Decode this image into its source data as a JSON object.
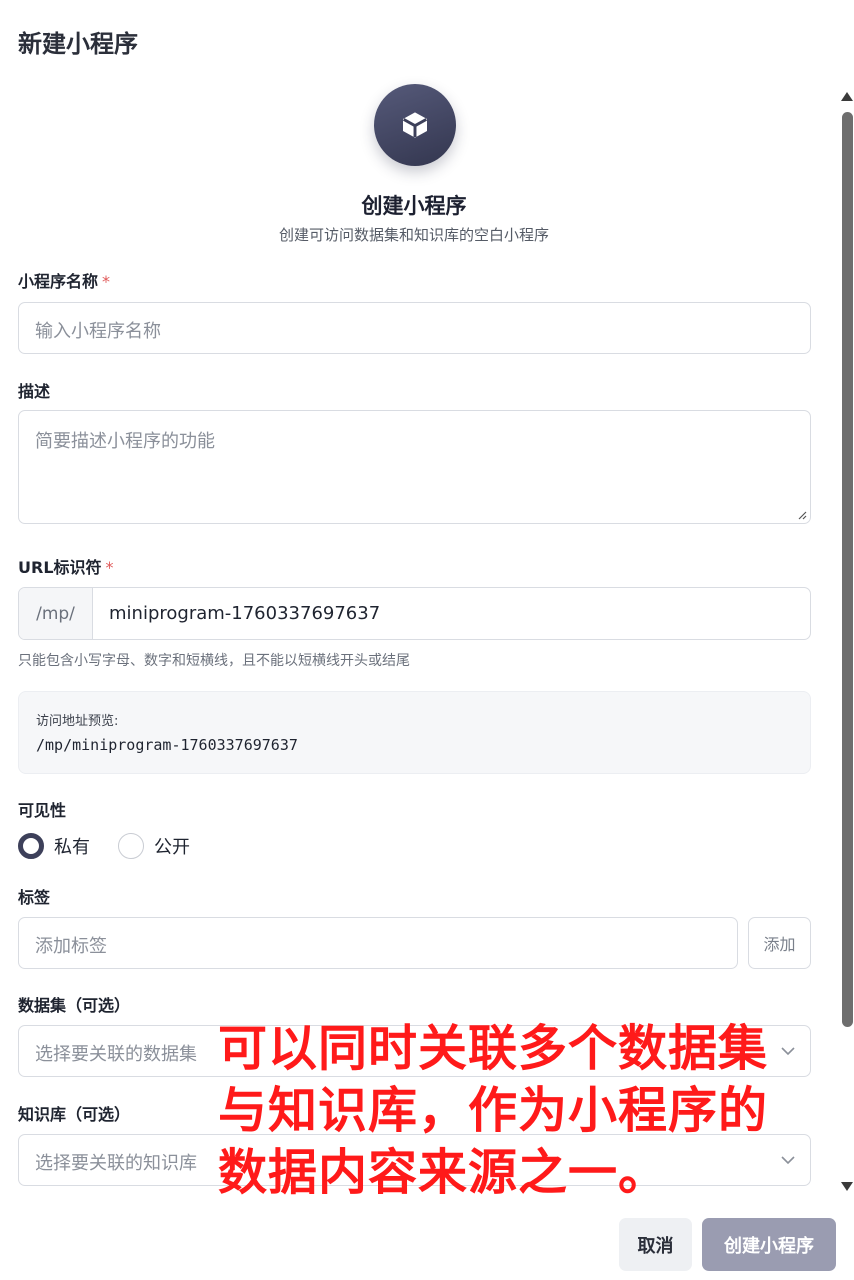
{
  "dialog": {
    "title": "新建小程序"
  },
  "hero": {
    "icon": "cube-icon",
    "title": "创建小程序",
    "subtitle": "创建可访问数据集和知识库的空白小程序"
  },
  "form": {
    "name": {
      "label": "小程序名称",
      "required_mark": "*",
      "placeholder": "输入小程序名称"
    },
    "description": {
      "label": "描述",
      "placeholder": "简要描述小程序的功能"
    },
    "url": {
      "label": "URL标识符",
      "required_mark": "*",
      "prefix": "/mp/",
      "value": "miniprogram-1760337697637",
      "hint": "只能包含小写字母、数字和短横线，且不能以短横线开头或结尾"
    },
    "preview": {
      "label": "访问地址预览:",
      "url": "/mp/miniprogram-1760337697637"
    },
    "visibility": {
      "label": "可见性",
      "options": [
        {
          "label": "私有",
          "selected": true
        },
        {
          "label": "公开",
          "selected": false
        }
      ]
    },
    "tags": {
      "label": "标签",
      "placeholder": "添加标签",
      "add_label": "添加"
    },
    "datasets": {
      "label": "数据集（可选）",
      "placeholder": "选择要关联的数据集"
    },
    "knowledge": {
      "label": "知识库（可选）",
      "placeholder": "选择要关联的知识库"
    }
  },
  "annotation": {
    "lines": [
      "可以同时关联多个数据集",
      "与知识库，作为小程序的",
      "数据内容来源之一。"
    ]
  },
  "actions": {
    "cancel": "取消",
    "create": "创建小程序"
  },
  "colors": {
    "accent": "#3d405a",
    "required": "#e05a5a",
    "annotation": "#ff1a1a",
    "primary_disabled": "#9a9cb1"
  }
}
